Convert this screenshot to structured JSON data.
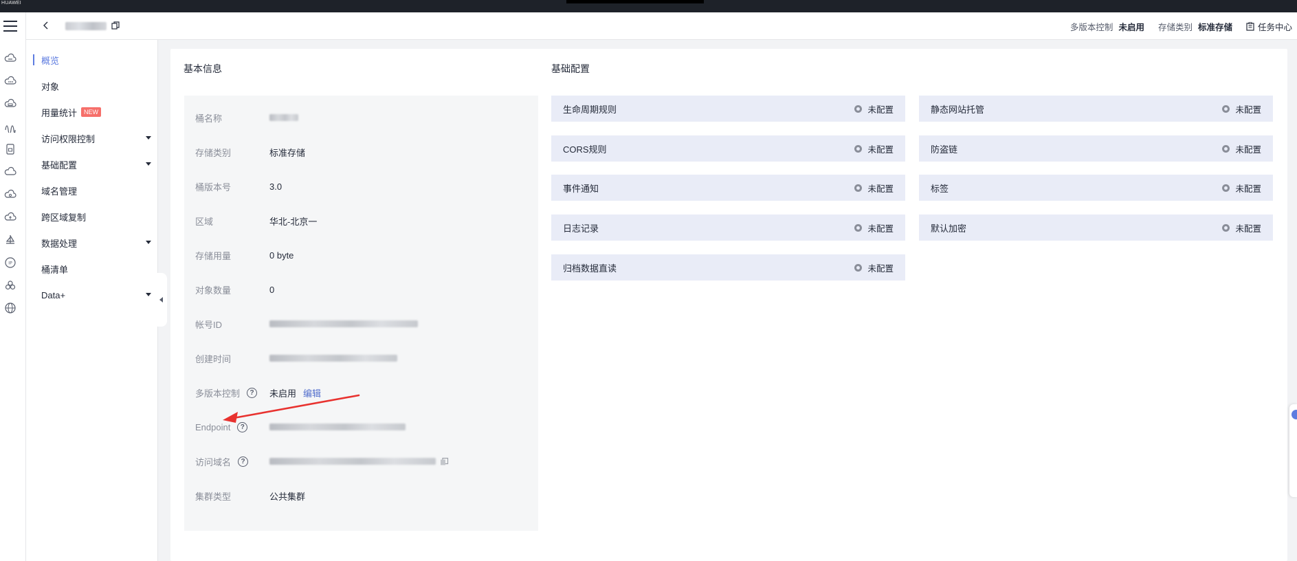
{
  "brand": "HUAWEI",
  "header": {
    "back_icon": "chevron-left-icon",
    "copy_icon": "copy-icon",
    "versioning_label": "多版本控制",
    "versioning_value": "未启用",
    "storage_class_label": "存储类别",
    "storage_class_value": "标准存储",
    "task_center_label": "任务中心",
    "task_center_icon": "clipboard-icon"
  },
  "sidebar": {
    "items": [
      {
        "label": "概览",
        "active": true,
        "expandable": false
      },
      {
        "label": "对象",
        "active": false,
        "expandable": false
      },
      {
        "label": "用量统计",
        "active": false,
        "expandable": false,
        "badge": "NEW"
      },
      {
        "label": "访问权限控制",
        "active": false,
        "expandable": true
      },
      {
        "label": "基础配置",
        "active": false,
        "expandable": true
      },
      {
        "label": "域名管理",
        "active": false,
        "expandable": false
      },
      {
        "label": "跨区域复制",
        "active": false,
        "expandable": false
      },
      {
        "label": "数据处理",
        "active": false,
        "expandable": true
      },
      {
        "label": "桶清单",
        "active": false,
        "expandable": false
      },
      {
        "label": "Data+",
        "active": false,
        "expandable": true
      }
    ]
  },
  "basic_info": {
    "title": "基本信息",
    "rows": [
      {
        "label": "桶名称",
        "value": "",
        "blurred": true
      },
      {
        "label": "存储类别",
        "value": "标准存储"
      },
      {
        "label": "桶版本号",
        "value": "3.0"
      },
      {
        "label": "区域",
        "value": "华北-北京一"
      },
      {
        "label": "存储用量",
        "value": "0 byte"
      },
      {
        "label": "对象数量",
        "value": "0"
      },
      {
        "label": "帐号ID",
        "value": "",
        "blurred": true
      },
      {
        "label": "创建时间",
        "value": "",
        "blurred": true
      },
      {
        "label": "多版本控制",
        "value": "未启用",
        "help": true,
        "link": "编辑"
      },
      {
        "label": "Endpoint",
        "value": "",
        "blurred": true,
        "help": true
      },
      {
        "label": "访问域名",
        "value": "",
        "blurred": true,
        "help": true,
        "copy": true
      },
      {
        "label": "集群类型",
        "value": "公共集群"
      }
    ]
  },
  "basic_config": {
    "title": "基础配置",
    "status_text": "未配置",
    "left": [
      "生命周期规则",
      "CORS规则",
      "事件通知",
      "日志记录",
      "归档数据直读"
    ],
    "right": [
      "静态网站托管",
      "防盗链",
      "标签",
      "默认加密"
    ]
  },
  "colors": {
    "accent": "#5e7ce0",
    "badge": "#f66f6a",
    "config_card_bg": "#e9ecf7",
    "annotation_arrow": "#e8322f"
  }
}
